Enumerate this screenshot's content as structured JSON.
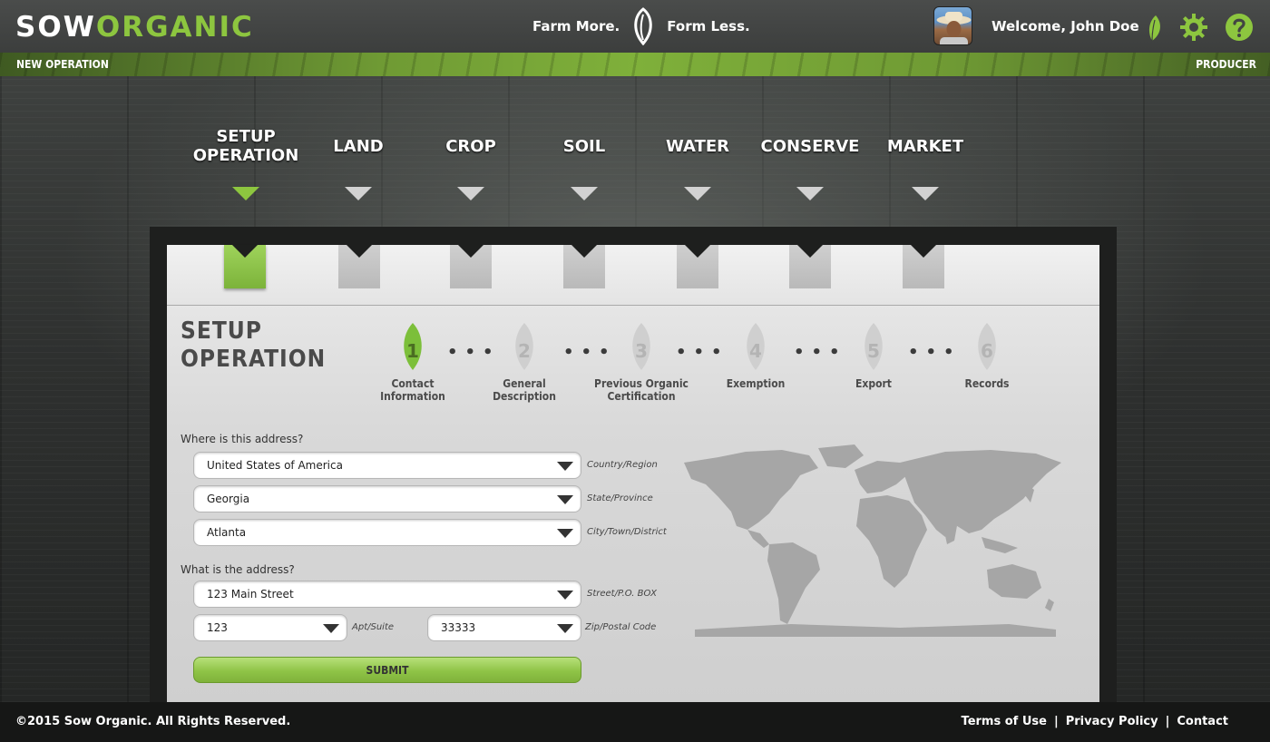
{
  "header": {
    "logo_part1": "SOW",
    "logo_part2": "ORGANIC",
    "tagline_left": "Farm More.",
    "tagline_right": "Form Less.",
    "welcome": "Welcome, John Doe",
    "icons": [
      "leaf-icon",
      "gear-icon",
      "help-icon"
    ]
  },
  "strip": {
    "left": "NEW OPERATION",
    "right": "PRODUCER"
  },
  "nav": [
    {
      "label": "SETUP\nOPERATION",
      "active": true
    },
    {
      "label": "LAND",
      "active": false
    },
    {
      "label": "CROP",
      "active": false
    },
    {
      "label": "SOIL",
      "active": false
    },
    {
      "label": "WATER",
      "active": false
    },
    {
      "label": "CONSERVE",
      "active": false
    },
    {
      "label": "MARKET",
      "active": false
    }
  ],
  "page_title": {
    "line1": "SETUP",
    "line2": "OPERATION"
  },
  "steps": [
    {
      "number": "1",
      "label": "Contact\nInformation",
      "active": true
    },
    {
      "number": "2",
      "label": "General\nDescription",
      "active": false
    },
    {
      "number": "3",
      "label": "Previous Organic\nCertification",
      "active": false
    },
    {
      "number": "4",
      "label": "Exemption",
      "active": false
    },
    {
      "number": "5",
      "label": "Export",
      "active": false
    },
    {
      "number": "6",
      "label": "Records",
      "active": false
    }
  ],
  "form": {
    "q1": "Where is this address?",
    "country": {
      "value": "United States of America",
      "hint": "Country/Region"
    },
    "state": {
      "value": "Georgia",
      "hint": "State/Province"
    },
    "city": {
      "value": "Atlanta",
      "hint": "City/Town/District"
    },
    "q2": "What is the address?",
    "street": {
      "value": "123 Main Street",
      "hint": "Street/P.O. BOX"
    },
    "apt": {
      "value": "123",
      "hint": "Apt/Suite"
    },
    "zip": {
      "value": "33333",
      "hint": "Zip/Postal Code"
    },
    "submit": "SUBMIT"
  },
  "footer": {
    "copyright": "©2015 Sow Organic. All Rights Reserved.",
    "links": [
      "Terms of Use",
      "Privacy Policy",
      "Contact"
    ],
    "separator": "|"
  },
  "colors": {
    "accent": "#8dc63f",
    "header_bg": "#424443",
    "footer_bg": "#161716"
  }
}
